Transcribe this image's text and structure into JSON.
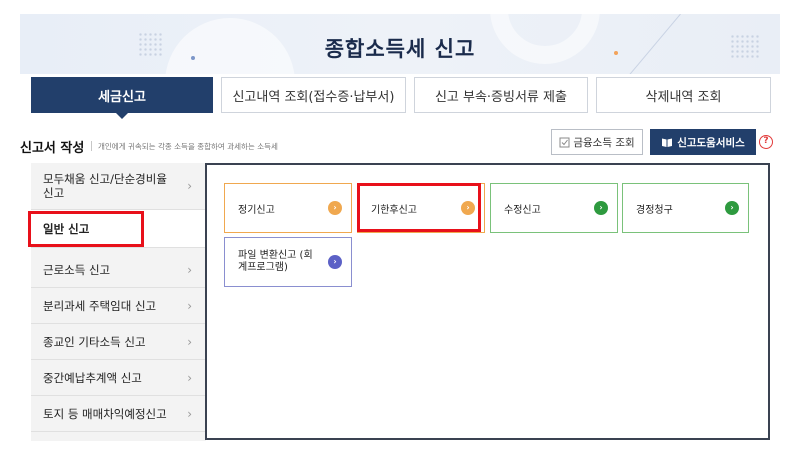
{
  "header": {
    "title": "종합소득세 신고"
  },
  "tabs": [
    {
      "label": "세금신고",
      "active": true
    },
    {
      "label": "신고내역 조회(접수증·납부서)"
    },
    {
      "label": "신고 부속·증빙서류 제출"
    },
    {
      "label": "삭제내역 조회"
    }
  ],
  "section": {
    "title": "신고서 작성",
    "description": "개인에게 귀속되는 각종 소득을 종합하여 과세하는 소득세",
    "finance_button": "금융소득 조회",
    "help_button": "신고도움서비스",
    "help_icon": "?"
  },
  "sidebar": {
    "items": [
      {
        "label": "모두채움 신고/단순경비율 신고",
        "chevron": "›"
      },
      {
        "label": "일반 신고",
        "active": true
      },
      {
        "label": "근로소득 신고",
        "chevron": "›"
      },
      {
        "label": "분리과세 주택임대 신고",
        "chevron": "›"
      },
      {
        "label": "종교인 기타소득 신고",
        "chevron": "›"
      },
      {
        "label": "중간예납추계액 신고",
        "chevron": "›"
      },
      {
        "label": "토지 등 매매차익예정신고",
        "chevron": "›"
      }
    ]
  },
  "cards": [
    {
      "label": "정기신고",
      "color": "#f0a84f"
    },
    {
      "label": "기한후신고",
      "color": "#f0a84f"
    },
    {
      "label": "수정신고",
      "color": "#2e9a3f"
    },
    {
      "label": "경정청구",
      "color": "#2e9a3f"
    },
    {
      "label": "파일 변환신고 (회계프로그램)",
      "color": "#5c61c6"
    }
  ],
  "card_arrow": "›",
  "colors": {
    "primary": "#223f6b",
    "highlight": "#e8101a"
  }
}
